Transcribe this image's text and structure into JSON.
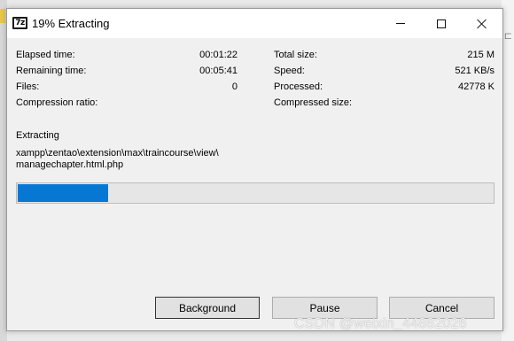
{
  "window": {
    "title": "19% Extracting",
    "app_icon_text": "7z",
    "controls": {
      "minimize": "minimize",
      "maximize": "maximize",
      "close": "close"
    }
  },
  "stats_left": [
    {
      "label": "Elapsed time:",
      "value": "00:01:22"
    },
    {
      "label": "Remaining time:",
      "value": "00:05:41"
    },
    {
      "label": "Files:",
      "value": "0"
    },
    {
      "label": "Compression ratio:",
      "value": ""
    }
  ],
  "stats_right": [
    {
      "label": "Total size:",
      "value": "215 M"
    },
    {
      "label": "Speed:",
      "value": "521 KB/s"
    },
    {
      "label": "Processed:",
      "value": "42778 K"
    },
    {
      "label": "Compressed size:",
      "value": ""
    }
  ],
  "status": {
    "label": "Extracting",
    "path_line1": "xampp\\zentao\\extension\\max\\traincourse\\view\\",
    "path_line2": "managechapter.html.php"
  },
  "progress": {
    "percent": 19,
    "color": "#0678d4"
  },
  "buttons": {
    "background": "Background",
    "pause": "Pause",
    "cancel": "Cancel"
  },
  "watermark": "CSDN @weixin_44882026",
  "background_right_glyph": "⊏"
}
